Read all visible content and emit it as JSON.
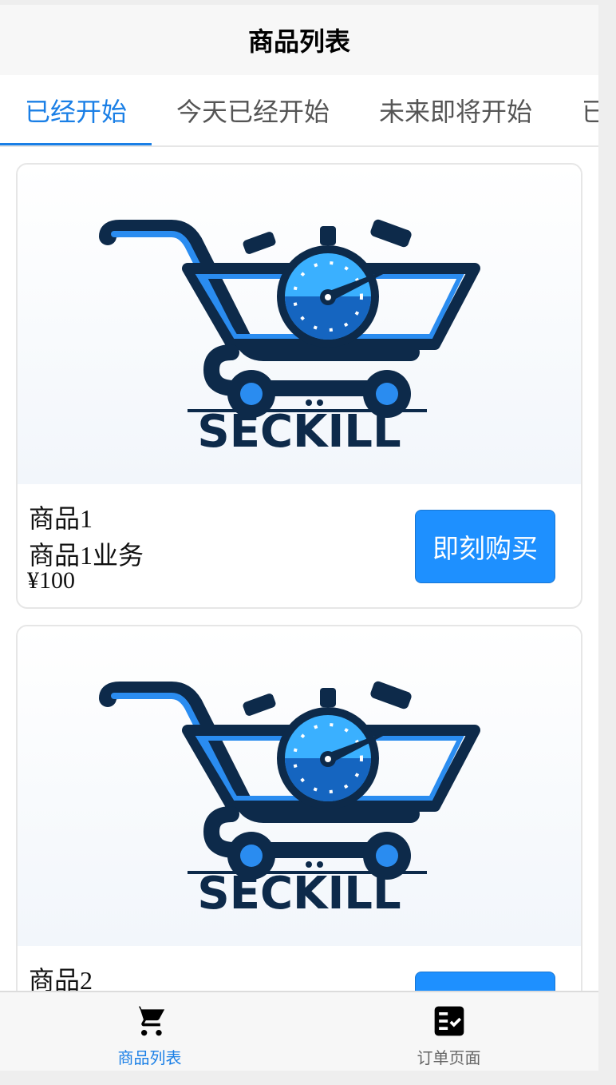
{
  "navbar": {
    "title": "商品列表"
  },
  "tabs": [
    {
      "label": "已经开始",
      "active": true
    },
    {
      "label": "今天已经开始",
      "active": false
    },
    {
      "label": "未来即将开始",
      "active": false
    },
    {
      "label": "已",
      "active": false
    }
  ],
  "products": [
    {
      "name": "商品1",
      "desc": "商品1业务",
      "price": "¥100",
      "buy_label": "即刻购买",
      "logo_text": "SECKILL"
    },
    {
      "name": "商品2",
      "desc": "",
      "price": "",
      "buy_label": "",
      "logo_text": "SECKILL"
    }
  ],
  "bottom_nav": [
    {
      "label": "商品列表",
      "icon": "cart-icon",
      "active": true
    },
    {
      "label": "订单页面",
      "icon": "order-list-icon",
      "active": false
    }
  ],
  "colors": {
    "accent": "#1a7fe6",
    "button": "#1e90ff",
    "logo_dark": "#0d2a4a",
    "logo_blue": "#2a8cf0"
  }
}
